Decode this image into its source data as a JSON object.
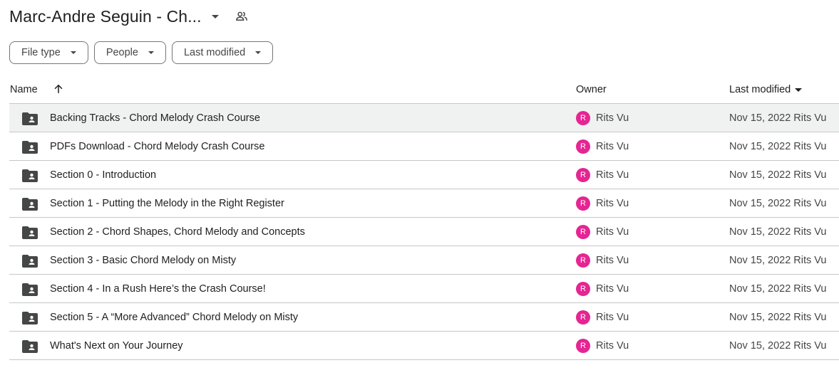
{
  "header": {
    "title": "Marc-Andre Seguin - Ch...",
    "shared_icon": "people-icon"
  },
  "filters": [
    {
      "label": "File type"
    },
    {
      "label": "People"
    },
    {
      "label": "Last modified"
    }
  ],
  "columns": {
    "name": "Name",
    "owner": "Owner",
    "last_modified": "Last modified"
  },
  "rows": [
    {
      "name": "Backing Tracks - Chord Melody Crash Course",
      "owner_initial": "R",
      "owner": "Rits Vu",
      "modified": "Nov 15, 2022 Rits Vu"
    },
    {
      "name": "PDFs Download - Chord Melody Crash Course",
      "owner_initial": "R",
      "owner": "Rits Vu",
      "modified": "Nov 15, 2022 Rits Vu"
    },
    {
      "name": "Section 0 - Introduction",
      "owner_initial": "R",
      "owner": "Rits Vu",
      "modified": "Nov 15, 2022 Rits Vu"
    },
    {
      "name": "Section 1 - Putting the Melody in the Right Register",
      "owner_initial": "R",
      "owner": "Rits Vu",
      "modified": "Nov 15, 2022 Rits Vu"
    },
    {
      "name": "Section 2 - Chord Shapes, Chord Melody and Concepts",
      "owner_initial": "R",
      "owner": "Rits Vu",
      "modified": "Nov 15, 2022 Rits Vu"
    },
    {
      "name": "Section 3 - Basic Chord Melody on Misty",
      "owner_initial": "R",
      "owner": "Rits Vu",
      "modified": "Nov 15, 2022 Rits Vu"
    },
    {
      "name": "Section 4 - In a Rush Here’s the Crash Course!",
      "owner_initial": "R",
      "owner": "Rits Vu",
      "modified": "Nov 15, 2022 Rits Vu"
    },
    {
      "name": "Section 5 - A “More Advanced” Chord Melody on Misty",
      "owner_initial": "R",
      "owner": "Rits Vu",
      "modified": "Nov 15, 2022 Rits Vu"
    },
    {
      "name": "What's Next on Your Journey",
      "owner_initial": "R",
      "owner": "Rits Vu",
      "modified": "Nov 15, 2022 Rits Vu"
    }
  ],
  "colors": {
    "avatar": "#e52592",
    "selected_row": "#f0f1f1",
    "divider": "#c7c7c7"
  }
}
